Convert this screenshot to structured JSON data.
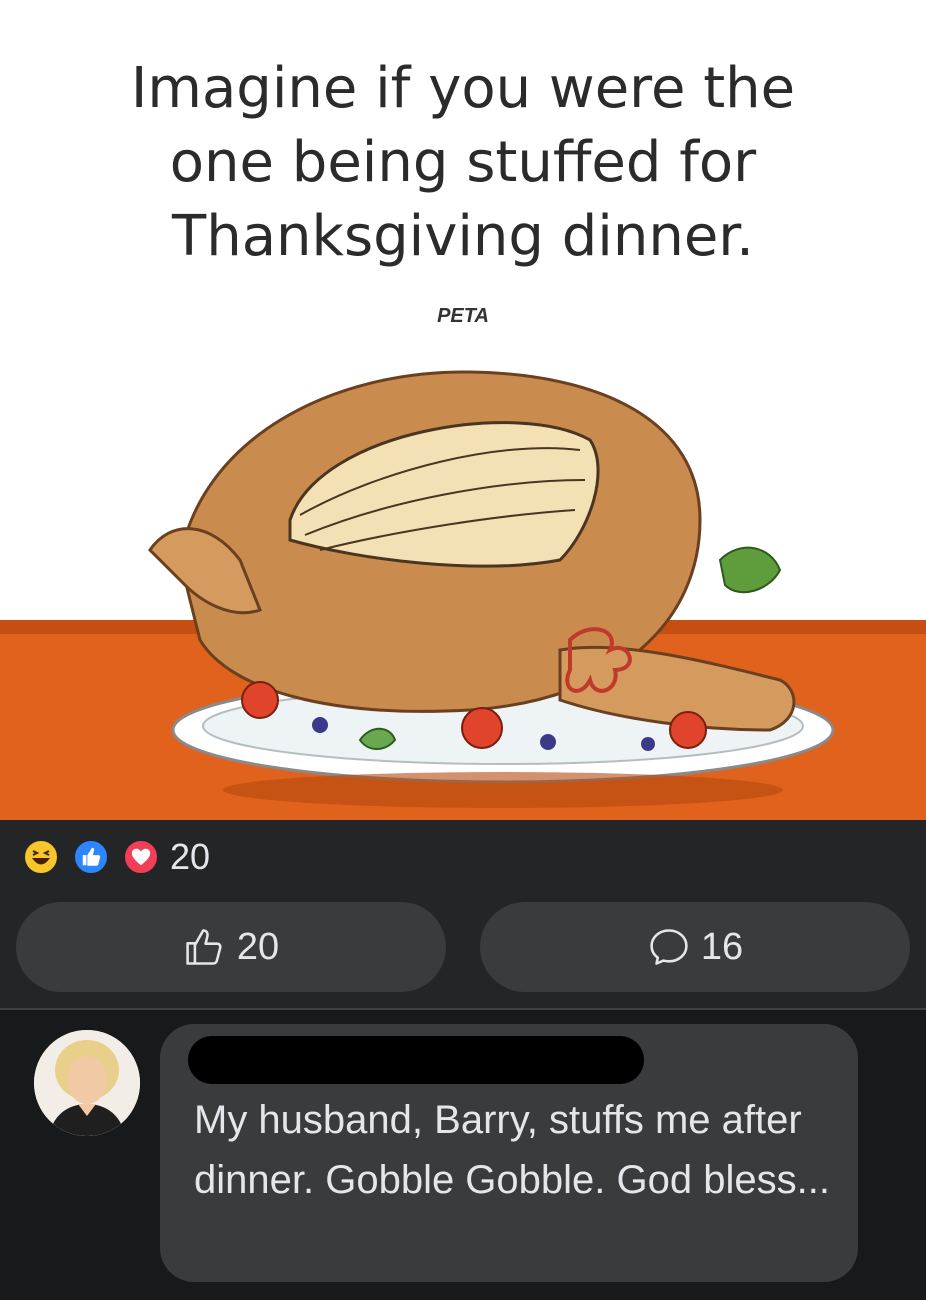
{
  "post": {
    "headline": [
      "Imagine if you were the",
      "one being stuffed for",
      "Thanksgiving dinner."
    ],
    "brand": "PETA"
  },
  "reactions": {
    "icons": [
      "haha-icon",
      "like-icon",
      "love-icon"
    ],
    "count": "20"
  },
  "actions": {
    "like_count": "20",
    "comment_count": "16"
  },
  "comment": {
    "text": "My husband, Barry, stuffs me after dinner. Gobble Gobble. God bless..."
  },
  "colors": {
    "background": "#18191a",
    "panel": "#242526",
    "button": "#3a3b3c",
    "text": "#e4e6eb",
    "table": "#e0621c",
    "like_blue": "#2d86ff",
    "love_red": "#f33e58",
    "haha_yellow": "#f7c62b"
  }
}
